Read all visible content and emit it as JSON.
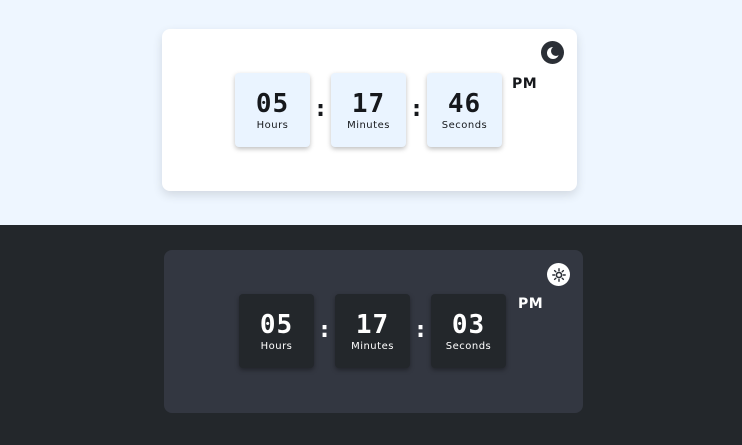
{
  "light_clock": {
    "toggle_icon": "moon-icon",
    "hours": {
      "value": "05",
      "label": "Hours"
    },
    "minutes": {
      "value": "17",
      "label": "Minutes"
    },
    "seconds": {
      "value": "46",
      "label": "Seconds"
    },
    "separator": ":",
    "period": "PM",
    "colors": {
      "background": "#eef6ff",
      "card": "#ffffff",
      "digit_box": "#eaf4ff",
      "text": "#16181c"
    }
  },
  "dark_clock": {
    "toggle_icon": "sun-icon",
    "hours": {
      "value": "05",
      "label": "Hours"
    },
    "minutes": {
      "value": "17",
      "label": "Minutes"
    },
    "seconds": {
      "value": "03",
      "label": "Seconds"
    },
    "separator": ":",
    "period": "PM",
    "colors": {
      "background": "#23272b",
      "card": "#333741",
      "digit_box": "#23272b",
      "text": "#ffffff"
    }
  }
}
